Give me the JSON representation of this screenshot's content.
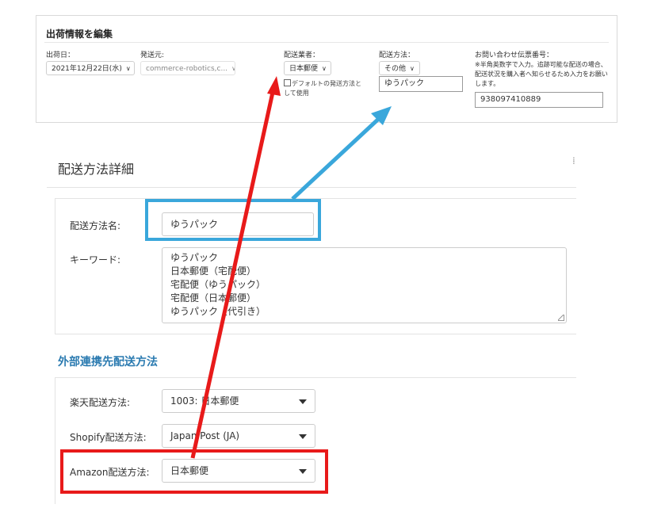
{
  "shipment_panel": {
    "title": "出荷情報を編集",
    "ship_date": {
      "label": "出荷日：",
      "value": "2021年12月22日(水)"
    },
    "origin": {
      "label": "発送元:",
      "value": "commerce-robotics,c..."
    },
    "carrier": {
      "label": "配送業者：",
      "value": "日本郵便",
      "default_checkbox": "デフォルトの発送方法として使用"
    },
    "method": {
      "label": "配送方法：",
      "value": "その他",
      "input_value": "ゆうパック"
    },
    "tracking": {
      "label": "お問い合わせ伝票番号：",
      "note": "※半角英数字で入力。追跡可能な配送の場合、配送状況を購入者へ知らせるため入力をお願いします。",
      "value": "938097410889"
    }
  },
  "detail": {
    "title": "配送方法詳細",
    "name_label": "配送方法名:",
    "name_value": "ゆうパック",
    "keyword_label": "キーワード:",
    "keywords": [
      "ゆうパック",
      "日本郵便（宅配便）",
      "宅配便（ゆうパック）",
      "宅配便（日本郵便）",
      "ゆうパック（代引き）"
    ]
  },
  "external": {
    "title": "外部連携先配送方法",
    "rows": [
      {
        "label": "楽天配送方法:",
        "value": "1003: 日本郵便"
      },
      {
        "label": "Shopify配送方法:",
        "value": "Japan Post (JA)"
      },
      {
        "label": "Amazon配送方法:",
        "value": "日本郵便"
      }
    ]
  },
  "annotation_colors": {
    "blue": "#3aa7db",
    "red": "#e81a1a"
  }
}
